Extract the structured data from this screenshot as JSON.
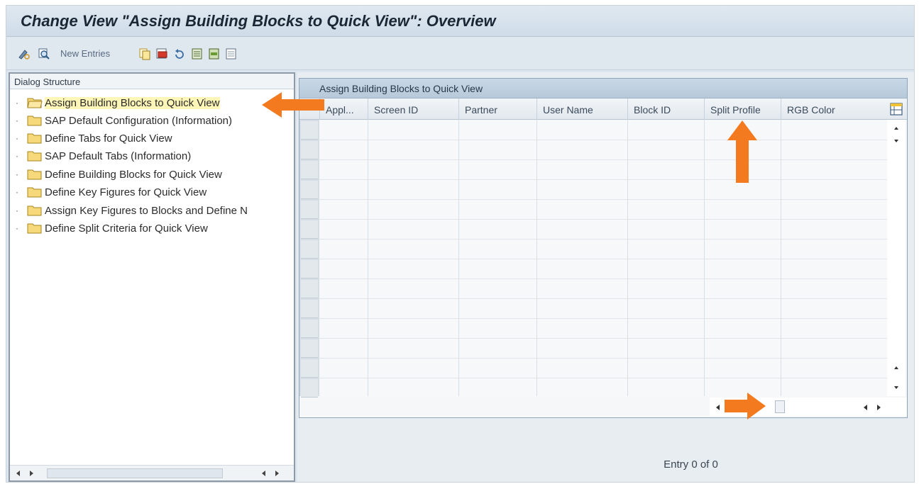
{
  "window": {
    "title": "Change View \"Assign Building Blocks to Quick View\": Overview"
  },
  "toolbar": {
    "new_entries_label": "New Entries",
    "icons": [
      "toggle-change-display-icon",
      "find-icon",
      "copy-icon",
      "delete-icon",
      "undo-icon",
      "select-all-icon",
      "select-block-icon",
      "deselect-all-icon"
    ]
  },
  "dialog_structure": {
    "header": "Dialog Structure",
    "items": [
      {
        "label": "Assign Building Blocks to Quick View",
        "selected": true
      },
      {
        "label": "SAP Default Configuration (Information)",
        "selected": false
      },
      {
        "label": "Define Tabs for Quick View",
        "selected": false
      },
      {
        "label": "SAP Default Tabs (Information)",
        "selected": false
      },
      {
        "label": "Define Building Blocks for Quick View",
        "selected": false
      },
      {
        "label": "Define Key Figures for Quick View",
        "selected": false
      },
      {
        "label": "Assign Key Figures to Blocks and Define N",
        "selected": false
      },
      {
        "label": "Define Split Criteria for Quick View",
        "selected": false
      }
    ]
  },
  "table": {
    "caption": "Assign Building Blocks to Quick View",
    "columns": [
      "Appl...",
      "Screen ID",
      "Partner",
      "User Name",
      "Block ID",
      "Split Profile",
      "RGB Color"
    ],
    "rows": []
  },
  "footer": {
    "entry_text": "Entry 0 of 0"
  },
  "colors": {
    "accent_arrow": "#f47a20",
    "selection_highlight": "#fff6b8",
    "folder": "#f3c64e"
  }
}
